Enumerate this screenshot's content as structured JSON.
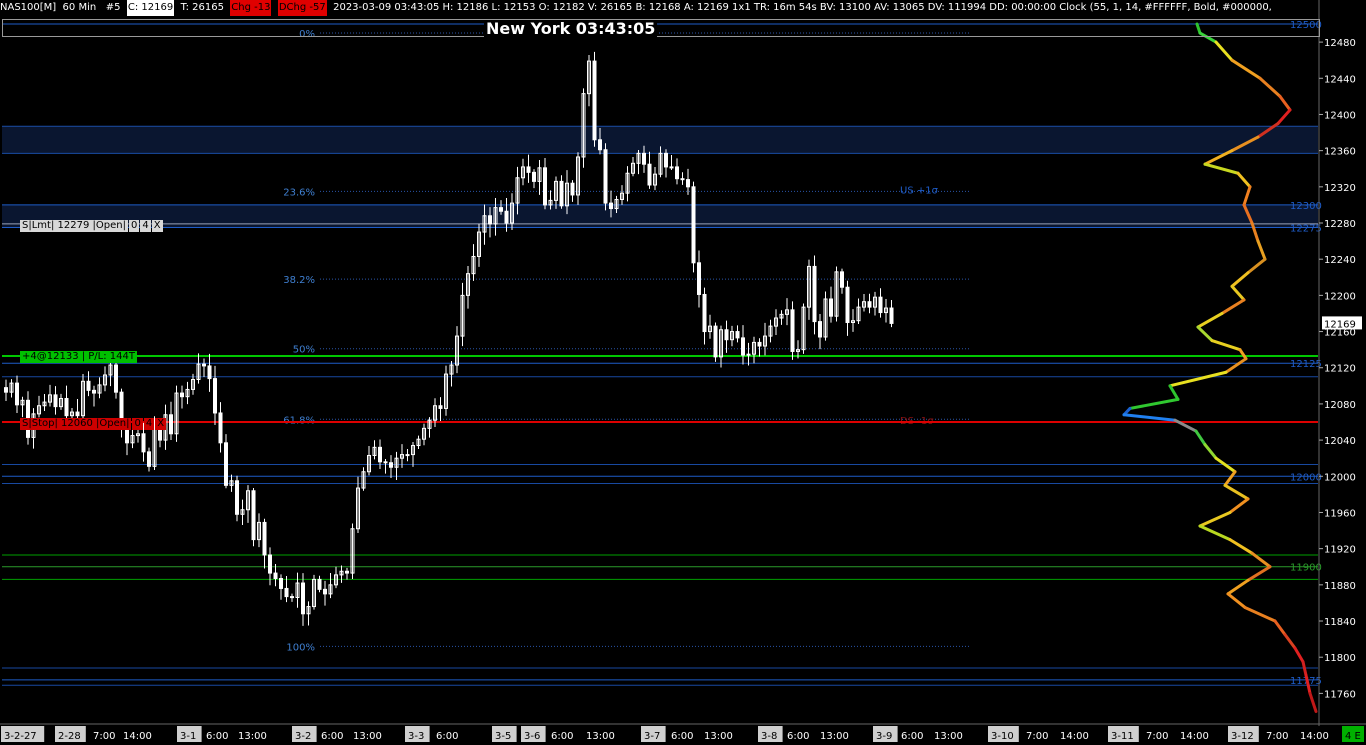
{
  "header": {
    "symbol": "NAS100[M]",
    "interval": "60 Min",
    "chart_no": "#5",
    "close_label": "C: 12169",
    "ticks": "T: 26165",
    "chg": "Chg -13",
    "dchg": "DChg -57",
    "rest": "2023-03-09 03:43:05 H: 12186 L: 12153 O: 12182 V: 26165 B: 12168 A: 12169 1x1 TR: 16m 54s BV: 13100 AV: 13065 DV: 111994 DD: 00:00:00 Clock (55, 1, 14, #FFFFFF, Bold, #000000,"
  },
  "clock": {
    "label": "New York 03:43:05"
  },
  "orders": {
    "limit": {
      "label": "S|Lmt| 12279 |Open|",
      "qty": "0",
      "count": "4",
      "close": "X",
      "price": 12279
    },
    "position": {
      "label": "+4@12133 | P/L: 144T",
      "price": 12133
    },
    "stop": {
      "label": "S|Stop| 12060 |Open|",
      "qty": "0",
      "count": "4",
      "close": "X",
      "price": 12060
    }
  },
  "colors": {
    "background": "#000000",
    "candle": "#ffffff",
    "blue_line": "#1e5cc8",
    "green_line": "#00c800",
    "red_line": "#dd0000",
    "fib_label": "#3f7fd0",
    "price_tag": "#3f7fd0"
  },
  "chart_data": {
    "type": "candlestick",
    "y_range": [
      11735,
      12500
    ],
    "y_ticks": [
      12480,
      12440,
      12400,
      12360,
      12320,
      12280,
      12240,
      12200,
      12160,
      12120,
      12080,
      12040,
      12000,
      11960,
      11920,
      11880,
      11840,
      11800,
      11760
    ],
    "current_price": {
      "label": "12169",
      "value": 12169
    },
    "x_labels": [
      "3-2-27",
      "2-28",
      "7:00",
      "14:00",
      "3-1",
      "6:00",
      "13:00",
      "3-2",
      "6:00",
      "13:00",
      "3-3",
      "6:00",
      "3-5",
      "3-6",
      "6:00",
      "13:00",
      "3-7",
      "6:00",
      "13:00",
      "3-8",
      "6:00",
      "13:00",
      "3-9",
      "6:00",
      "13:00",
      "3-10",
      "7:00",
      "14:00",
      "3-11",
      "7:00",
      "14:00",
      "3-12",
      "7:00",
      "14:00"
    ],
    "x_boxed": [
      "3-2-27",
      "2-28",
      "3-1",
      "3-2",
      "3-3",
      "3-5",
      "3-6",
      "3-7",
      "3-8",
      "3-9",
      "3-10",
      "3-11",
      "3-12"
    ],
    "corner_label": "4 E",
    "fib_levels": [
      {
        "label": "0%",
        "price": 12490
      },
      {
        "label": "23.6%",
        "price": 12315
      },
      {
        "label": "38.2%",
        "price": 12218
      },
      {
        "label": "50%",
        "price": 12141
      },
      {
        "label": "61.8%",
        "price": 12063
      },
      {
        "label": "100%",
        "price": 11812
      }
    ],
    "band_annotations": [
      {
        "label": "US +1σ",
        "price": 12317,
        "color": "#1e5cc8"
      },
      {
        "label": "DS -1σ",
        "price": 12062,
        "color": "#8a1010"
      }
    ],
    "level_lines": [
      {
        "label": "12500",
        "price": 12500,
        "color": "#1e5cc8"
      },
      {
        "label": "12300",
        "price": 12300,
        "color": "#1e5cc8"
      },
      {
        "label": "12275",
        "price": 12275,
        "color": "#1e5cc8"
      },
      {
        "label": "12125",
        "price": 12125,
        "color": "#1e5cc8"
      },
      {
        "label": "12000",
        "price": 12000,
        "color": "#1e5cc8"
      },
      {
        "label": "11900",
        "price": 11900,
        "color": "#2a9a2a"
      },
      {
        "label": "11775",
        "price": 11775,
        "color": "#1e5cc8"
      }
    ],
    "closes": [
      12093,
      12103,
      12079,
      12084,
      12043,
      12069,
      12078,
      12082,
      12090,
      12077,
      12086,
      12067,
      12071,
      12067,
      12105,
      12095,
      12092,
      12101,
      12112,
      12123,
      12093,
      12057,
      12037,
      12045,
      12047,
      12027,
      12011,
      12058,
      12040,
      12068,
      12047,
      12092,
      12088,
      12096,
      12107,
      12124,
      12122,
      12108,
      12070,
      12037,
      11990,
      11995,
      11958,
      11963,
      11984,
      11930,
      11949,
      11913,
      11893,
      11887,
      11876,
      11867,
      11866,
      11882,
      11848,
      11856,
      11886,
      11875,
      11870,
      11880,
      11891,
      11895,
      11893,
      11942,
      11987,
      12005,
      12023,
      12032,
      12016,
      12015,
      12010,
      12020,
      12024,
      12024,
      12034,
      12041,
      12053,
      12062,
      12078,
      12075,
      12113,
      12123,
      12155,
      12200,
      12224,
      12243,
      12270,
      12288,
      12279,
      12297,
      12293,
      12280,
      12302,
      12330,
      12342,
      12336,
      12326,
      12341,
      12300,
      12305,
      12326,
      12299,
      12324,
      12311,
      12353,
      12423,
      12459,
      12372,
      12361,
      12302,
      12296,
      12306,
      12313,
      12335,
      12346,
      12357,
      12345,
      12322,
      12334,
      12357,
      12342,
      12342,
      12329,
      12328,
      12320,
      12236,
      12201,
      12160,
      12166,
      12132,
      12162,
      12151,
      12160,
      12153,
      12134,
      12135,
      12148,
      12144,
      12155,
      12166,
      12175,
      12179,
      12184,
      12138,
      12140,
      12187,
      12232,
      12171,
      12154,
      12196,
      12177,
      12226,
      12209,
      12170,
      12172,
      12187,
      12193,
      12187,
      12198,
      12181,
      12186,
      12169
    ],
    "volume_profile_note": "price histogram at right edge"
  }
}
